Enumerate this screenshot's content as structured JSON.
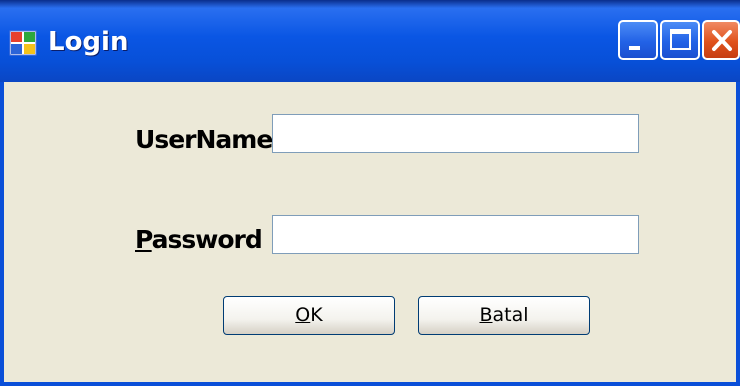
{
  "window": {
    "title": "Login",
    "app_icon": "windows-form-icon",
    "controls": {
      "minimize_icon": "minimize-icon",
      "maximize_icon": "maximize-icon",
      "close_icon": "close-icon"
    }
  },
  "form": {
    "username_label_first": "U",
    "username_label_rest": "serName",
    "password_label_first": "P",
    "password_label_rest": "assword",
    "username_value": "",
    "password_value": ""
  },
  "buttons": {
    "ok_first": "O",
    "ok_rest": "K",
    "cancel_first": "B",
    "cancel_rest": "atal"
  },
  "colors": {
    "titlebar": "#0a56e4",
    "window_border": "#0a4fd8",
    "client_background": "#ece9d8",
    "close_button": "#e0521c"
  }
}
